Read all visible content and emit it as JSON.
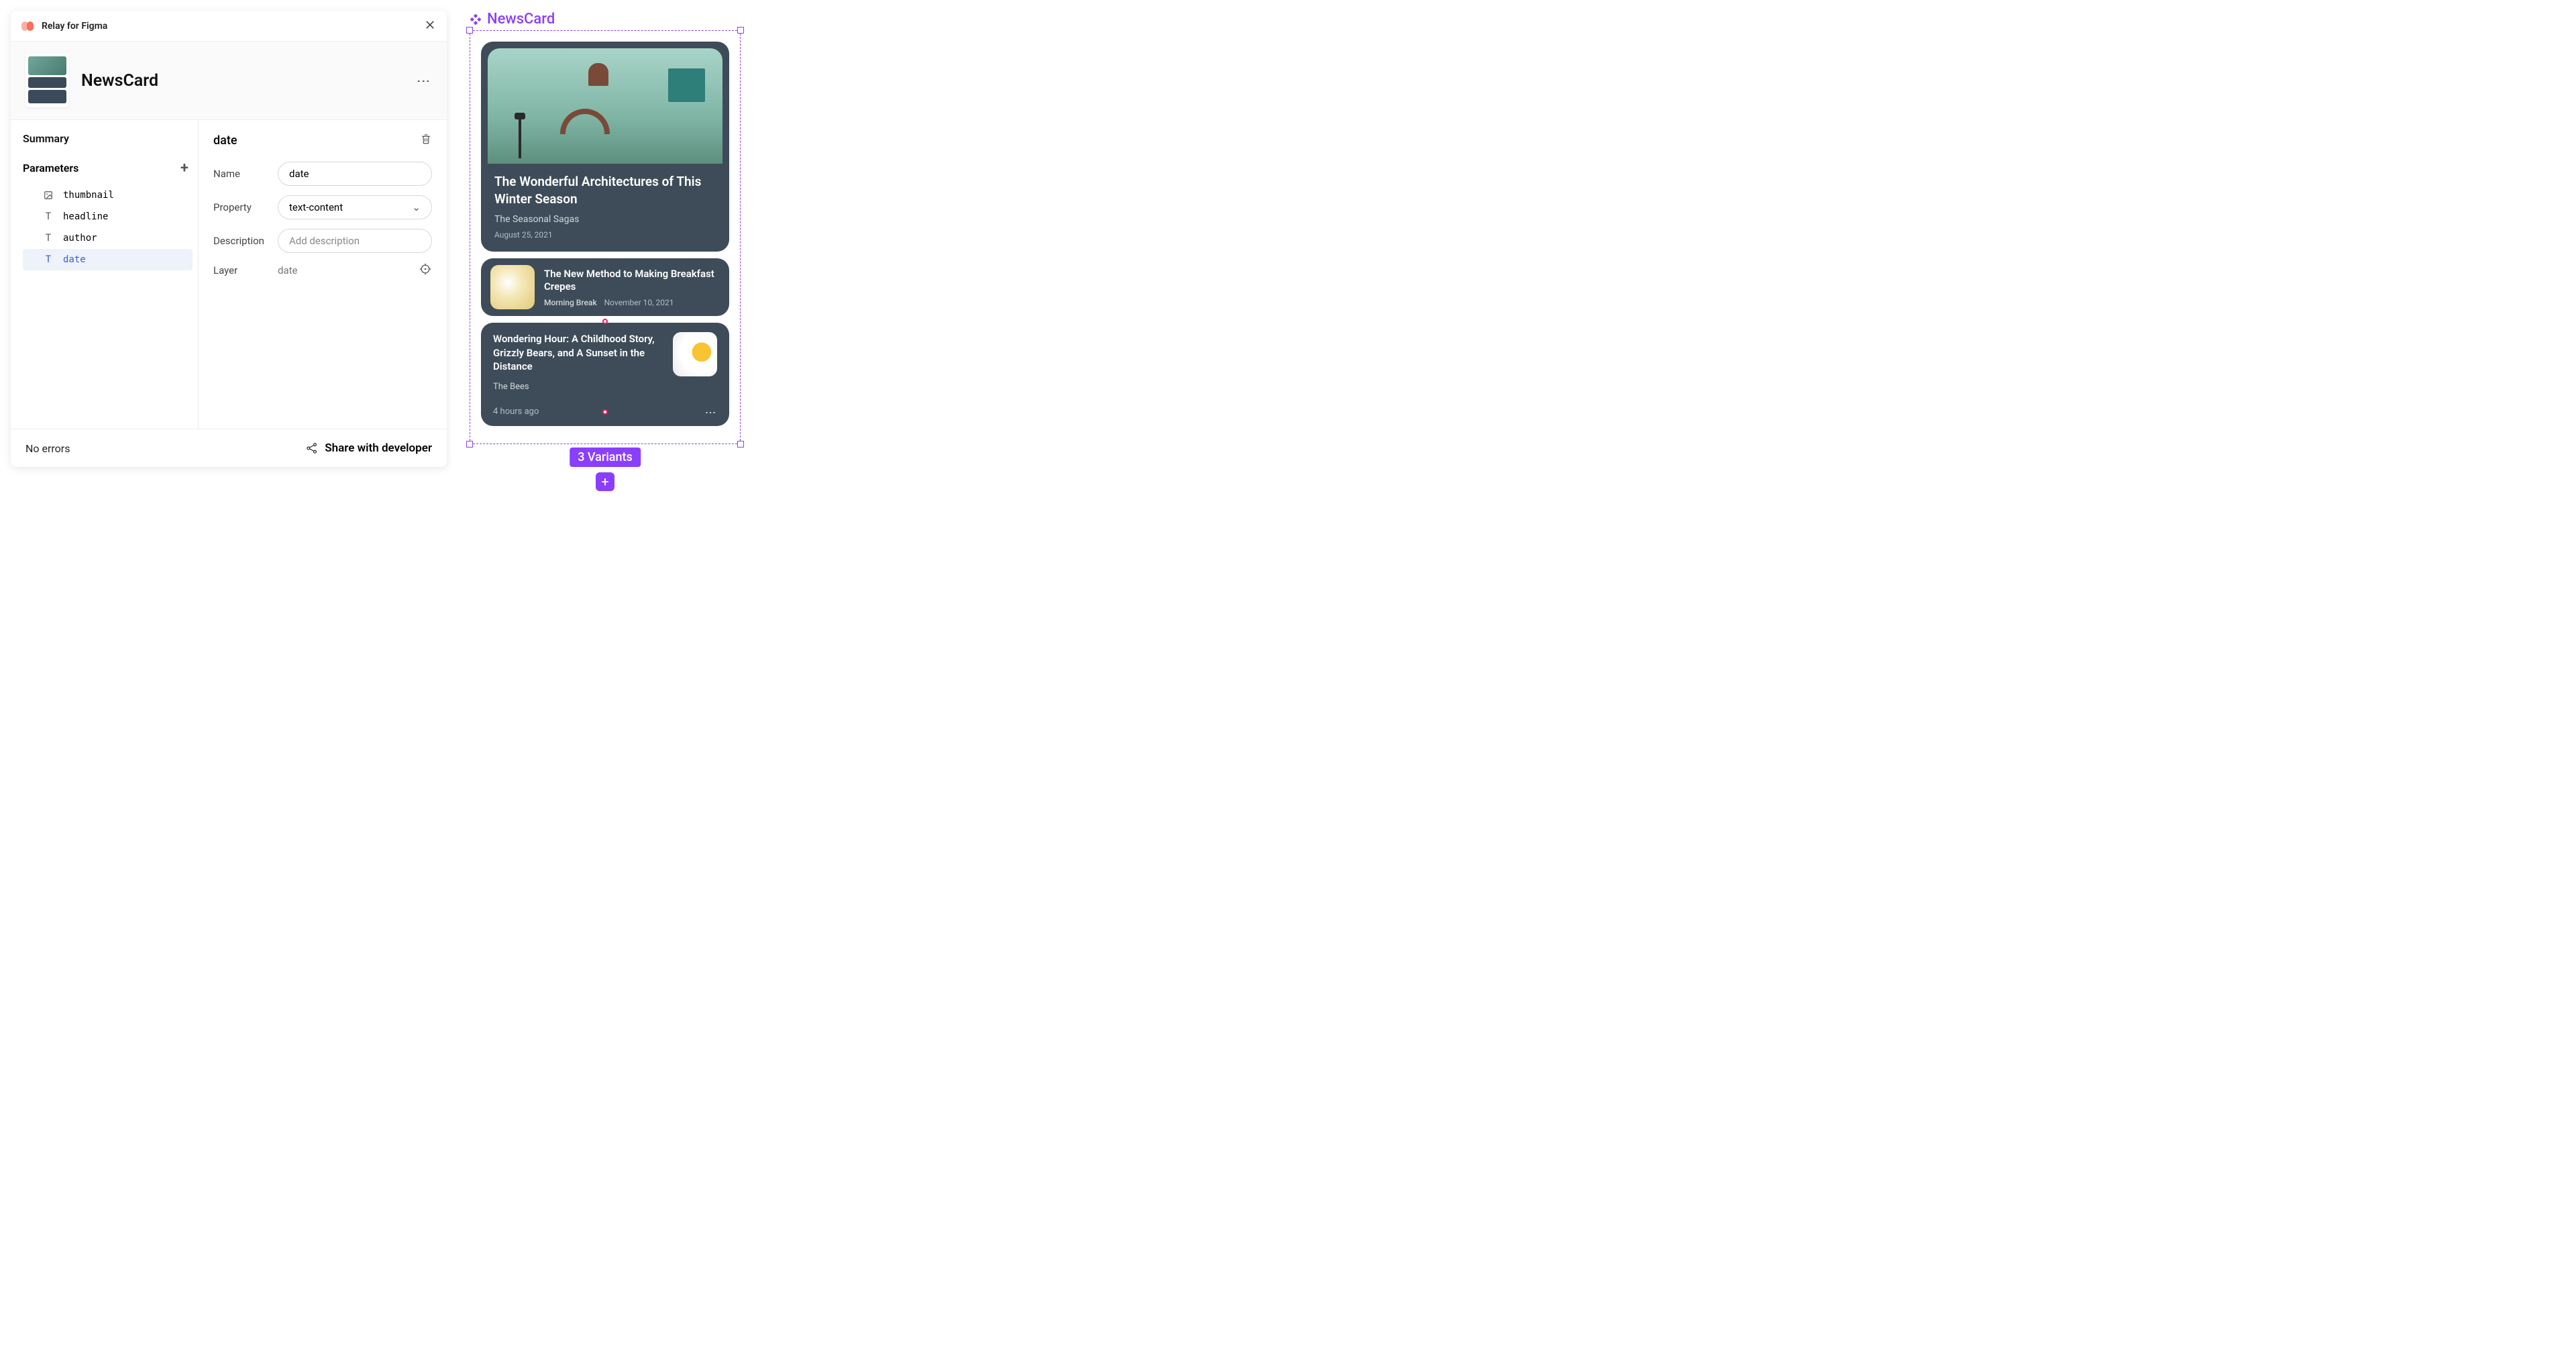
{
  "plugin": {
    "title": "Relay for Figma"
  },
  "component": {
    "name": "NewsCard"
  },
  "sidebar": {
    "summary": "Summary",
    "parameters_heading": "Parameters",
    "params": [
      {
        "icon": "image",
        "name": "thumbnail"
      },
      {
        "icon": "text",
        "name": "headline"
      },
      {
        "icon": "text",
        "name": "author"
      },
      {
        "icon": "text",
        "name": "date"
      }
    ],
    "selected_index": 3
  },
  "detail": {
    "title": "date",
    "fields": {
      "name_label": "Name",
      "name_value": "date",
      "property_label": "Property",
      "property_value": "text-content",
      "description_label": "Description",
      "description_placeholder": "Add description",
      "layer_label": "Layer",
      "layer_value": "date"
    }
  },
  "footer": {
    "errors": "No errors",
    "share": "Share with developer"
  },
  "canvas": {
    "component_label": "NewsCard",
    "variants_badge": "3 Variants",
    "cards": [
      {
        "headline": "The Wonderful Architectures of This Winter Season",
        "author": "The Seasonal Sagas",
        "date": "August 25, 2021"
      },
      {
        "headline": "The New Method to Making Breakfast Crepes",
        "author": "Morning Break",
        "date": "November 10, 2021"
      },
      {
        "headline": "Wondering Hour: A Childhood Story, Grizzly Bears, and A Sunset in the Distance",
        "author": "The Bees",
        "date": "4 hours ago"
      }
    ]
  }
}
